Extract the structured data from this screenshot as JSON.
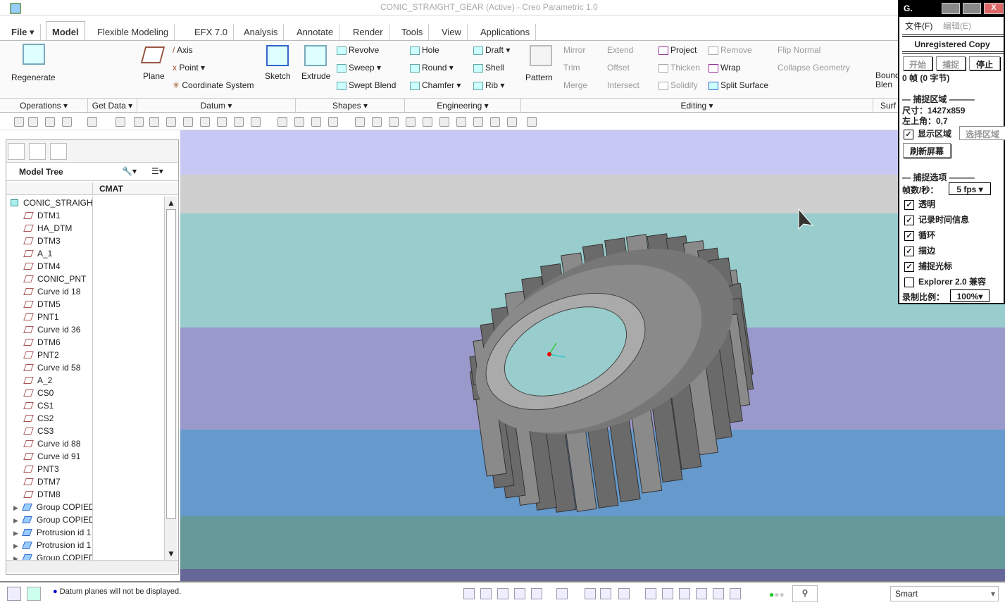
{
  "window": {
    "title": "CONIC_STRAIGHT_GEAR (Active) - Creo Parametric 1.0"
  },
  "tabs": [
    "File",
    "Model",
    "Flexible Modeling",
    "EFX 7.0",
    "Analysis",
    "Annotate",
    "Render",
    "Tools",
    "View",
    "Applications"
  ],
  "ribbon": {
    "operations": {
      "regenerate": "Regenerate"
    },
    "datum": {
      "plane": "Plane",
      "axis": "Axis",
      "point": "Point",
      "csys": "Coordinate System"
    },
    "sketch": "Sketch",
    "shapes": {
      "extrude": "Extrude",
      "revolve": "Revolve",
      "sweep": "Sweep",
      "swept_blend": "Swept Blend"
    },
    "engineering": {
      "hole": "Hole",
      "round": "Round",
      "chamfer": "Chamfer",
      "draft": "Draft",
      "shell": "Shell",
      "rib": "Rib"
    },
    "editing": {
      "pattern": "Pattern",
      "mirror": "Mirror",
      "trim": "Trim",
      "merge": "Merge",
      "extend": "Extend",
      "offset": "Offset",
      "intersect": "Intersect",
      "project": "Project",
      "thicken": "Thicken",
      "solidify": "Solidify",
      "wrap": "Wrap",
      "remove": "Remove",
      "split_surface": "Split Surface",
      "flip_normal": "Flip Normal",
      "collapse_geometry": "Collapse Geometry",
      "boundary_blend": "Bound Blen"
    },
    "groups": [
      "Operations",
      "Get Data",
      "Datum",
      "Shapes",
      "Engineering",
      "Editing",
      "Surf"
    ]
  },
  "model_tree": {
    "title": "Model Tree",
    "column": "CMAT",
    "root": "CONIC_STRAIGH",
    "items": [
      "DTM1",
      "HA_DTM",
      "DTM3",
      "A_1",
      "DTM4",
      "CONIC_PNT",
      "Curve id 18",
      "DTM5",
      "PNT1",
      "Curve id 36",
      "DTM6",
      "PNT2",
      "Curve id 58",
      "A_2",
      "CS0",
      "CS1",
      "CS2",
      "CS3",
      "Curve id 88",
      "Curve id 91",
      "PNT3",
      "DTM7",
      "DTM8"
    ],
    "groups": [
      "Group COPIED",
      "Group COPIED",
      "Protrusion id 1",
      "Protrusion id 1",
      "Group COPIED"
    ]
  },
  "viewport": {
    "bands": [
      "#c8c8f4",
      "#cfcfcf",
      "#99cccc",
      "#9999cc",
      "#6699cc",
      "#669999",
      "#666699"
    ]
  },
  "status": {
    "message": "Datum planes will not be displayed.",
    "filter": "Smart"
  },
  "capture": {
    "title": "G.",
    "menu": [
      "文件(F)",
      "编辑(E)"
    ],
    "banner": "Unregistered Copy",
    "buttons": [
      "开始",
      "捕捉",
      "停止"
    ],
    "frames": "0 帧 (0 字节)",
    "area_header": "捕捉区域",
    "size": "尺寸：1427x859",
    "topleft": "左上角：0,7",
    "show_area": "显示区域",
    "select_area": "选择区域",
    "refresh": "刷新屏幕",
    "options_header": "捕捉选项",
    "fps_label": "帧数/秒：",
    "fps": "5 fps",
    "options": [
      {
        "label": "透明",
        "checked": true
      },
      {
        "label": "记录时间信息",
        "checked": true
      },
      {
        "label": "循环",
        "checked": true
      },
      {
        "label": "描边",
        "checked": true
      },
      {
        "label": "捕捉光标",
        "checked": true
      },
      {
        "label": "Explorer 2.0 兼容",
        "checked": false
      }
    ],
    "scale_label": "录制比例：",
    "scale": "100%"
  }
}
